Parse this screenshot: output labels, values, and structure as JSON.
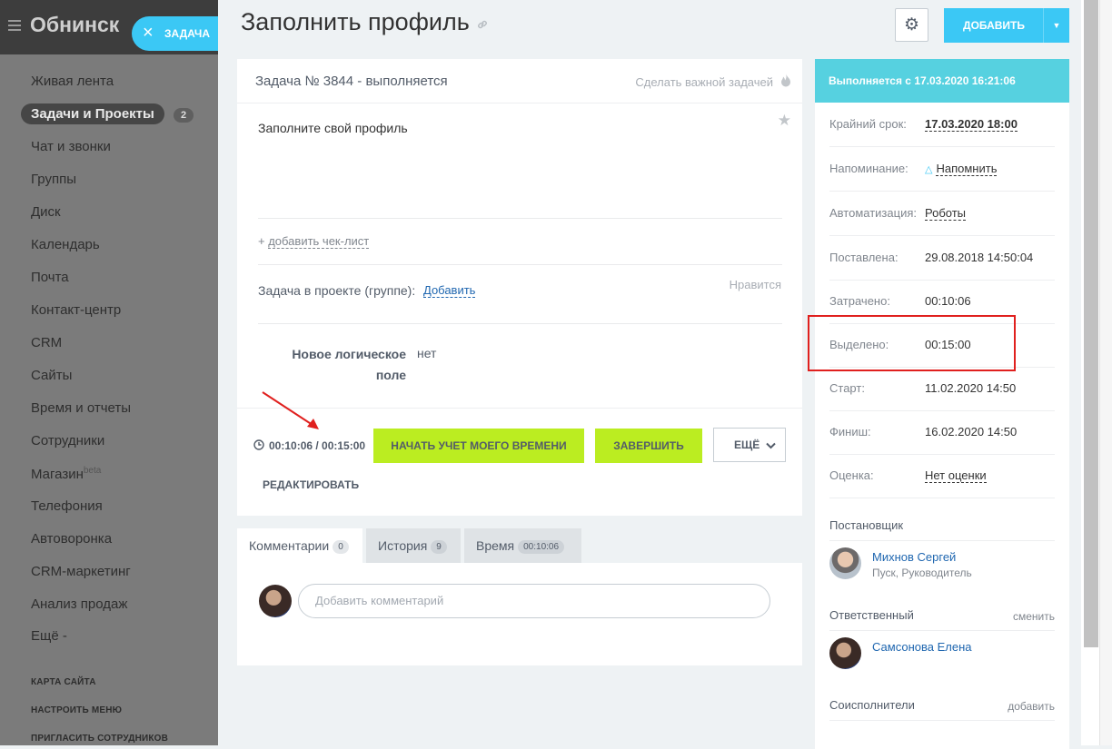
{
  "sidebar": {
    "portal_title": "Обнинск",
    "task_tab_label": "ЗАДАЧА",
    "items": [
      {
        "label": "Живая лента"
      },
      {
        "label": "Задачи и Проекты",
        "counter": "2"
      },
      {
        "label": "Чат и звонки"
      },
      {
        "label": "Группы"
      },
      {
        "label": "Диск"
      },
      {
        "label": "Календарь"
      },
      {
        "label": "Почта"
      },
      {
        "label": "Контакт-центр"
      },
      {
        "label": "CRM"
      },
      {
        "label": "Сайты"
      },
      {
        "label": "Время и отчеты"
      },
      {
        "label": "Сотрудники"
      },
      {
        "label": "Магазин",
        "badge": "beta"
      },
      {
        "label": "Телефония"
      },
      {
        "label": "Автоворонка"
      },
      {
        "label": "CRM-маркетинг"
      },
      {
        "label": "Анализ продаж"
      },
      {
        "label": "Ещё -"
      }
    ],
    "footer_links": [
      "КАРТА САЙТА",
      "НАСТРОИТЬ МЕНЮ",
      "ПРИГЛАСИТЬ СОТРУДНИКОВ"
    ]
  },
  "header": {
    "title": "Заполнить профиль",
    "add_button": "ДОБАВИТЬ"
  },
  "task": {
    "status": "Задача № 3844 - выполняется",
    "make_important": "Сделать важной задачей",
    "description": "Заполните свой профиль",
    "add_checklist": "добавить чек-лист",
    "project_label": "Задача в проекте (группе):",
    "project_add": "Добавить",
    "like": "Нравится",
    "custom_field_name": "Новое логическое поле",
    "custom_field_value": "нет",
    "timer": "00:10:06 / 00:15:00",
    "start_timer_btn": "НАЧАТЬ УЧЕТ МОЕГО ВРЕМЕНИ",
    "complete_btn": "ЗАВЕРШИТЬ",
    "more_btn": "ЕЩЁ",
    "edit_link": "РЕДАКТИРОВАТЬ"
  },
  "tabs": [
    {
      "label": "Комментарии",
      "count": "0"
    },
    {
      "label": "История",
      "count": "9"
    },
    {
      "label": "Время",
      "count": "00:10:06"
    }
  ],
  "comments": {
    "placeholder": "Добавить комментарий"
  },
  "details": {
    "status_header": "Выполняется с 17.03.2020 16:21:06",
    "rows": [
      {
        "key": "Крайний срок:",
        "value": "17.03.2020 18:00"
      },
      {
        "key": "Напоминание:",
        "value": "Напомнить"
      },
      {
        "key": "Автоматизация:",
        "value": "Роботы"
      },
      {
        "key": "Поставлена:",
        "value": "29.08.2018 14:50:04"
      },
      {
        "key": "Затрачено:",
        "value": "00:10:06"
      },
      {
        "key": "Выделено:",
        "value": "00:15:00"
      },
      {
        "key": "Старт:",
        "value": "11.02.2020 14:50"
      },
      {
        "key": "Финиш:",
        "value": "16.02.2020 14:50"
      },
      {
        "key": "Оценка:",
        "value": "Нет оценки"
      }
    ],
    "creator_title": "Постановщик",
    "creator_name": "Михнов Сергей",
    "creator_role": "Пуск, Руководитель",
    "responsible_title": "Ответственный",
    "responsible_action": "сменить",
    "responsible_name": "Самсонова Елена",
    "coexecutors_title": "Соисполнители",
    "coexecutors_action": "добавить"
  },
  "colors": {
    "accent": "#3bc8f5",
    "status_header": "#56d1e0",
    "success_button": "#bbed21",
    "highlight": "#e0201e"
  }
}
